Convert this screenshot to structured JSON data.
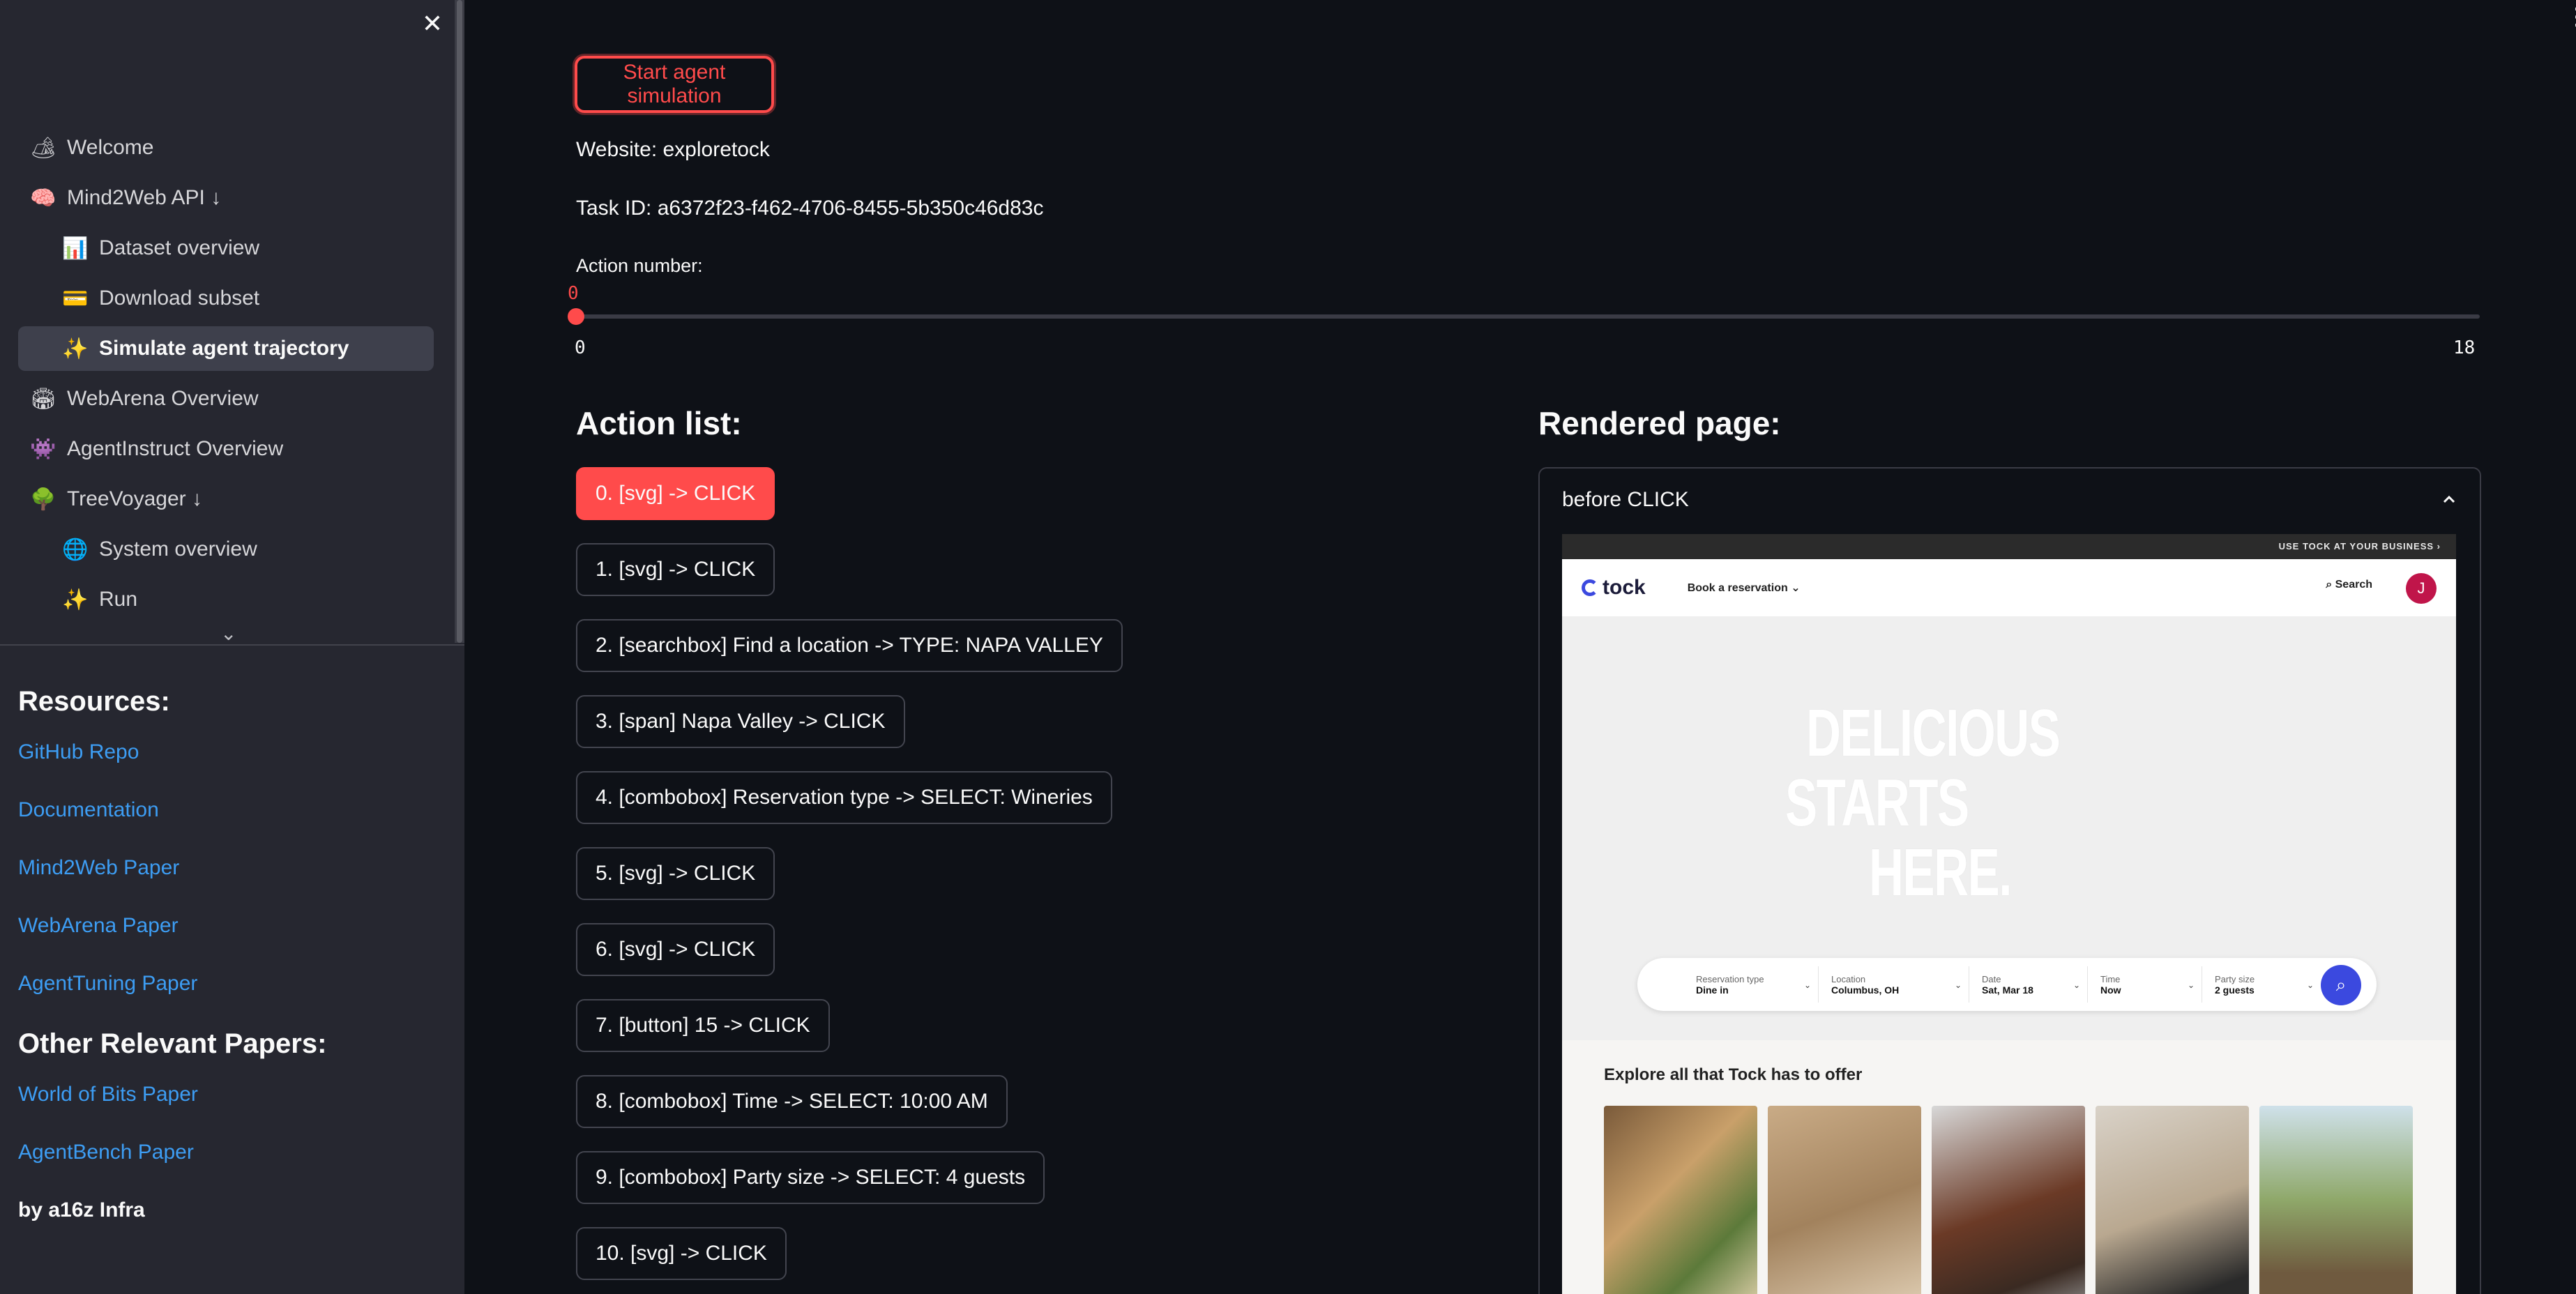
{
  "sidebar": {
    "nav": [
      {
        "label": "Welcome",
        "icon": "🏕",
        "level": 0,
        "active": false
      },
      {
        "label": "Mind2Web API ↓",
        "icon": "🧠",
        "level": 0,
        "active": false
      },
      {
        "label": "Dataset overview",
        "icon": "📊",
        "level": 1,
        "active": false
      },
      {
        "label": "Download subset",
        "icon": "💳",
        "level": 1,
        "active": false
      },
      {
        "label": "Simulate agent trajectory",
        "icon": "✨",
        "level": 1,
        "active": true
      },
      {
        "label": "WebArena Overview",
        "icon": "🏟",
        "level": 0,
        "active": false
      },
      {
        "label": "AgentInstruct Overview",
        "icon": "👾",
        "level": 0,
        "active": false
      },
      {
        "label": "TreeVoyager ↓",
        "icon": "🌳",
        "level": 0,
        "active": false
      },
      {
        "label": "System overview",
        "icon": "🌐",
        "level": 1,
        "active": false
      },
      {
        "label": "Run",
        "icon": "✨",
        "level": 1,
        "active": false
      }
    ],
    "resources_title": "Resources:",
    "resources": [
      "GitHub Repo",
      "Documentation",
      "Mind2Web Paper",
      "WebArena Paper",
      "AgentTuning Paper"
    ],
    "other_title": "Other Relevant Papers:",
    "other": [
      "World of Bits Paper",
      "AgentBench Paper"
    ],
    "credit": "by a16z Infra"
  },
  "main": {
    "start_button": "Start agent simulation",
    "website": "Website: exploretock",
    "task_id": "Task ID: a6372f23-f462-4706-8455-5b350c46d83c",
    "slider": {
      "label": "Action number:",
      "value": "0",
      "min": "0",
      "max": "18"
    },
    "action_list_title": "Action list:",
    "actions": [
      "0. [svg] -> CLICK",
      "1. [svg] -> CLICK",
      "2. [searchbox] Find a location -> TYPE: NAPA VALLEY",
      "3. [span] Napa Valley -> CLICK",
      "4. [combobox] Reservation type -> SELECT: Wineries",
      "5. [svg] -> CLICK",
      "6. [svg] -> CLICK",
      "7. [button] 15 -> CLICK",
      "8. [combobox] Time -> SELECT: 10:00 AM",
      "9. [combobox] Party size -> SELECT: 4 guests",
      "10. [svg] -> CLICK"
    ],
    "rendered_title": "Rendered page:",
    "expander_label": "before CLICK"
  },
  "screenshot": {
    "topbar": "USE TOCK AT YOUR BUSINESS ›",
    "logo": "tock",
    "book": "Book a reservation ⌄",
    "search": "Search",
    "avatar": "J",
    "hero": [
      "DELICIOUS",
      "STARTS",
      "HERE."
    ],
    "fields": [
      {
        "label": "Reservation type",
        "value": "Dine in"
      },
      {
        "label": "Location",
        "value": "Columbus, OH"
      },
      {
        "label": "Date",
        "value": "Sat, Mar 18"
      },
      {
        "label": "Time",
        "value": "Now"
      },
      {
        "label": "Party size",
        "value": "2 guests"
      }
    ],
    "explore": "Explore all that Tock has to offer"
  },
  "colors": {
    "accent": "#ff4b4b",
    "link": "#3d9df3",
    "sidebar_bg": "#262730",
    "main_bg": "#0e1117",
    "tock_blue": "#3b49df"
  }
}
